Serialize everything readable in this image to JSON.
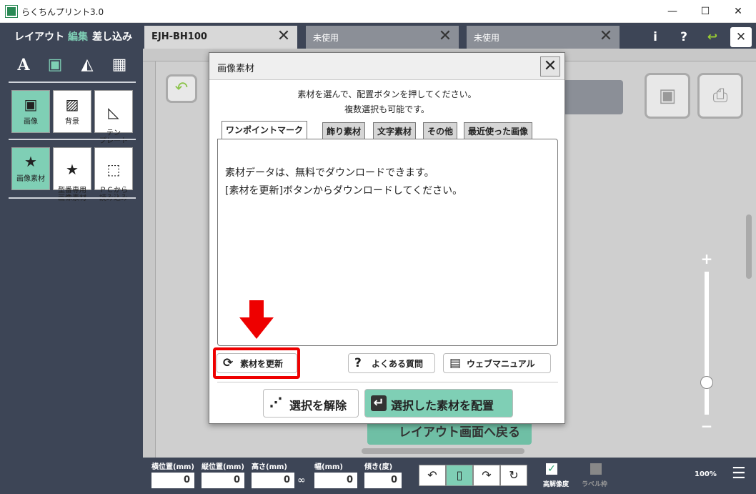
{
  "window": {
    "title": "らくちんプリント3.0",
    "min": "—",
    "max": "☐",
    "close": "✕"
  },
  "modes": {
    "layout": "レイアウト",
    "edit": "編集",
    "merge": "差し込み"
  },
  "tabs": [
    {
      "label": "EJH-BH100",
      "close": "✕"
    },
    {
      "label": "未使用",
      "close": "✕"
    },
    {
      "label": "未使用",
      "close": "✕"
    }
  ],
  "header_icons": {
    "info": "i",
    "help": "?",
    "undo": "↩",
    "close": "✕"
  },
  "toolbar_icons": {
    "text": "A",
    "image": "▣",
    "shape": "◭",
    "qr": "▦"
  },
  "tools_row1": [
    {
      "label": "画像",
      "icon": "▣"
    },
    {
      "label": "背景",
      "icon": "▨"
    },
    {
      "label": "テン\nプレート",
      "icon": "◺"
    }
  ],
  "tools_row2": [
    {
      "label": "画像素材",
      "icon": "★"
    },
    {
      "label": "型番専用\n画像素材",
      "icon": "★"
    },
    {
      "label": "ＰＣから\n読み込み",
      "icon": "⬚"
    }
  ],
  "dialog": {
    "title": "画像素材",
    "close": "✕",
    "instruction1": "素材を選んで、配置ボタンを押してください。",
    "instruction2": "複数選択も可能です。",
    "tabs": [
      "ワンポイントマーク",
      "飾り素材",
      "文字素材",
      "その他",
      "最近使った画像"
    ],
    "message1": "素材データは、無料でダウンロードできます。",
    "message2": "[素材を更新]ボタンからダウンロードしてください。",
    "update_button": "素材を更新",
    "faq_button": "よくある質問",
    "manual_button": "ウェブマニュアル",
    "deselect_button": "選択を解除",
    "place_button": "選択した素材を配置"
  },
  "background_button": "レイアウト画面へ戻る",
  "bottom": {
    "fields": [
      {
        "label": "横位置(mm)",
        "value": "0"
      },
      {
        "label": "縦位置(mm)",
        "value": "0"
      },
      {
        "label": "高さ(mm)",
        "value": "0"
      },
      {
        "label": "幅(mm)",
        "value": "0"
      },
      {
        "label": "傾き(度)",
        "value": "0"
      }
    ],
    "high_res": "高解像度",
    "label_frame": "ラベル枠",
    "zoom": "100%"
  },
  "zoom_plus": "+",
  "zoom_minus": "−",
  "colors": {
    "accent": "#7fcfb5",
    "sidebar": "#3d4556",
    "highlight": "#e00000"
  }
}
